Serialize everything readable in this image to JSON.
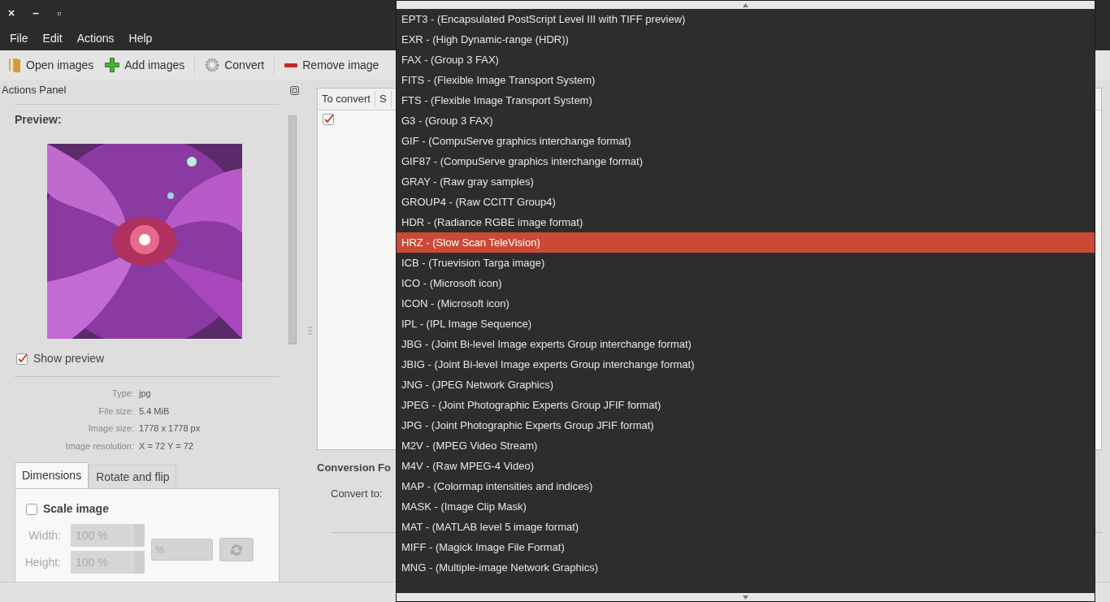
{
  "window": {
    "controls": [
      "×",
      "–",
      "▫"
    ]
  },
  "menu": [
    {
      "label": "File"
    },
    {
      "label": "Edit"
    },
    {
      "label": "Actions"
    },
    {
      "label": "Help"
    }
  ],
  "toolbar": [
    {
      "kind": "button",
      "label": "Open images"
    },
    {
      "kind": "button",
      "label": "Add images"
    },
    {
      "kind": "separator"
    },
    {
      "kind": "button",
      "label": "Convert"
    },
    {
      "kind": "separator"
    },
    {
      "kind": "button",
      "label": "Remove image"
    }
  ],
  "actions_panel": {
    "title": "Actions Panel",
    "preview_heading": "Preview:",
    "show_preview": {
      "label": "Show preview",
      "checked": true
    },
    "info": [
      {
        "label": "Type:",
        "value": "jpg"
      },
      {
        "label": "File size:",
        "value": "5.4 MiB"
      },
      {
        "label": "Image size:",
        "value": "1778 x 1778 px"
      },
      {
        "label": "Image resolution:",
        "value": "X = 72 Y = 72"
      }
    ],
    "tabs": [
      {
        "label": "Dimensions",
        "selected": true
      },
      {
        "label": "Rotate and flip",
        "selected": false
      }
    ],
    "scale_image": {
      "label": "Scale image",
      "checked": false
    },
    "width": {
      "label": "Width:",
      "value": "100 %",
      "disabled": true
    },
    "unit": {
      "value": "%",
      "disabled": true
    },
    "height": {
      "label": "Height:",
      "value": "100 %",
      "disabled": true
    }
  },
  "file_list": {
    "columns": [
      "To convert",
      "S"
    ],
    "rows": [
      {
        "checked": true
      }
    ]
  },
  "conversion": {
    "heading": "Conversion Fo",
    "convert_to_label": "Convert to:"
  },
  "format_dropdown": {
    "items": [
      {
        "label": "EPT3 - (Encapsulated PostScript Level III with TIFF preview)",
        "selected": false
      },
      {
        "label": "EXR - (High Dynamic-range (HDR))",
        "selected": false
      },
      {
        "label": "FAX - (Group 3 FAX)",
        "selected": false
      },
      {
        "label": "FITS - (Flexible Image Transport System)",
        "selected": false
      },
      {
        "label": "FTS - (Flexible Image Transport System)",
        "selected": false
      },
      {
        "label": "G3 - (Group 3 FAX)",
        "selected": false
      },
      {
        "label": "GIF - (CompuServe graphics interchange format)",
        "selected": false
      },
      {
        "label": "GIF87 - (CompuServe graphics interchange format)",
        "selected": false
      },
      {
        "label": "GRAY - (Raw gray samples)",
        "selected": false
      },
      {
        "label": "GROUP4 - (Raw CCITT Group4)",
        "selected": false
      },
      {
        "label": "HDR - (Radiance RGBE image format)",
        "selected": false
      },
      {
        "label": "HRZ - (Slow Scan TeleVision)",
        "selected": true
      },
      {
        "label": "ICB - (Truevision Targa image)",
        "selected": false
      },
      {
        "label": "ICO - (Microsoft icon)",
        "selected": false
      },
      {
        "label": "ICON - (Microsoft icon)",
        "selected": false
      },
      {
        "label": "IPL - (IPL Image Sequence)",
        "selected": false
      },
      {
        "label": "JBG - (Joint Bi-level Image experts Group interchange format)",
        "selected": false
      },
      {
        "label": "JBIG - (Joint Bi-level Image experts Group interchange format)",
        "selected": false
      },
      {
        "label": "JNG - (JPEG Network Graphics)",
        "selected": false
      },
      {
        "label": "JPEG - (Joint Photographic Experts Group JFIF format)",
        "selected": false
      },
      {
        "label": "JPG - (Joint Photographic Experts Group JFIF format)",
        "selected": false
      },
      {
        "label": "M2V - (MPEG Video Stream)",
        "selected": false
      },
      {
        "label": "M4V - (Raw MPEG-4 Video)",
        "selected": false
      },
      {
        "label": "MAP - (Colormap intensities and indices)",
        "selected": false
      },
      {
        "label": "MASK - (Image Clip Mask)",
        "selected": false
      },
      {
        "label": "MAT - (MATLAB level 5 image format)",
        "selected": false
      },
      {
        "label": "MIFF - (Magick Image File Format)",
        "selected": false
      },
      {
        "label": "MNG - (Multiple-image Network Graphics)",
        "selected": false
      }
    ]
  }
}
